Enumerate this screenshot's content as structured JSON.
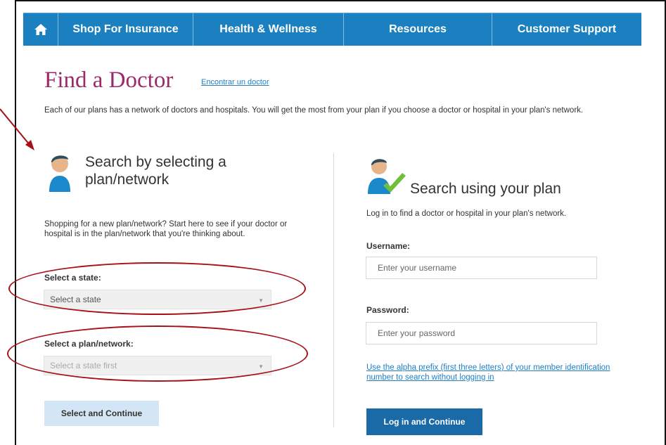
{
  "nav": {
    "home_icon": "home-icon",
    "items": [
      {
        "label": "Shop For Insurance"
      },
      {
        "label": "Health & Wellness"
      },
      {
        "label": "Resources"
      },
      {
        "label": "Customer Support"
      }
    ]
  },
  "page": {
    "title": "Find a Doctor",
    "spanish_link": "Encontrar un doctor",
    "intro": "Each of our plans has a network of doctors and hospitals. You will get the most from your plan if you choose a doctor or hospital in your plan's network."
  },
  "left": {
    "heading": "Search by selecting a plan/network",
    "description": "Shopping for a new plan/network? Start here to see if your doctor or hospital is in the plan/network that you're thinking about.",
    "state_label": "Select a state:",
    "state_value": "Select a state",
    "plan_label": "Select a plan/network:",
    "plan_value": "Select a state first",
    "button": "Select and Continue"
  },
  "right": {
    "heading": "Search using your plan",
    "description": "Log in to find a doctor or hospital in your plan's network.",
    "username_label": "Username:",
    "username_placeholder": "Enter your username",
    "password_label": "Password:",
    "password_placeholder": "Enter your password",
    "alpha_link": "Use the alpha prefix (first three letters) of your member identification number to search without logging in",
    "button": "Log in and Continue"
  },
  "colors": {
    "nav_bg": "#1b80bf",
    "title": "#9b2a66",
    "link": "#1f7ec5",
    "annotation": "#a80f16",
    "primary_button": "#1a6aa8",
    "secondary_button": "#d4e6f5"
  }
}
